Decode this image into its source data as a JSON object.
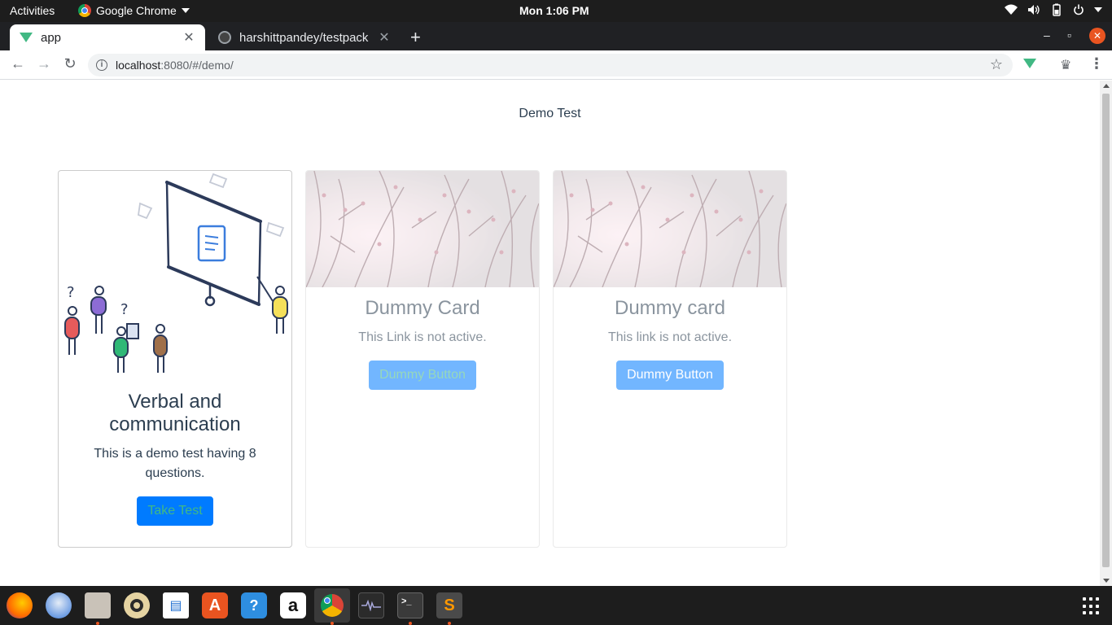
{
  "system_bar": {
    "activities": "Activities",
    "app_name": "Google Chrome",
    "clock": "Mon  1:06 PM",
    "tray_icons": [
      "wifi-icon",
      "volume-icon",
      "battery-icon",
      "power-icon"
    ]
  },
  "tabs": [
    {
      "title": "app",
      "icon": "vue-icon",
      "active": true
    },
    {
      "title": "harshittpandey/testpack",
      "icon": "github-icon",
      "active": false
    }
  ],
  "toolbar": {
    "url_host": "localhost",
    "url_rest": ":8080/#/demo/"
  },
  "page": {
    "title": "Demo Test",
    "cards": [
      {
        "title": "Verbal and communication",
        "text": "This is a demo test having 8 questions.",
        "button": "Take Test",
        "image": "presentation-illustration",
        "enabled": true
      },
      {
        "title": "Dummy Card",
        "text": "This Link is not active.",
        "button": "Dummy Button",
        "image": "blossom-branches-photo",
        "enabled": false
      },
      {
        "title": "Dummy card",
        "text": "This link is not active.",
        "button": "Dummy Button",
        "image": "blossom-branches-photo",
        "enabled": false
      }
    ]
  },
  "dock": {
    "apps": [
      "firefox-icon",
      "thunderbird-icon",
      "files-icon",
      "rhythmbox-icon",
      "writer-icon",
      "software-icon",
      "help-icon",
      "amazon-icon",
      "chrome-icon",
      "system-monitor-icon",
      "terminal-icon",
      "sublime-icon"
    ],
    "colors": {
      "accent": "#e95420",
      "button_primary": "#007bff",
      "button_text": "#42b983"
    }
  }
}
